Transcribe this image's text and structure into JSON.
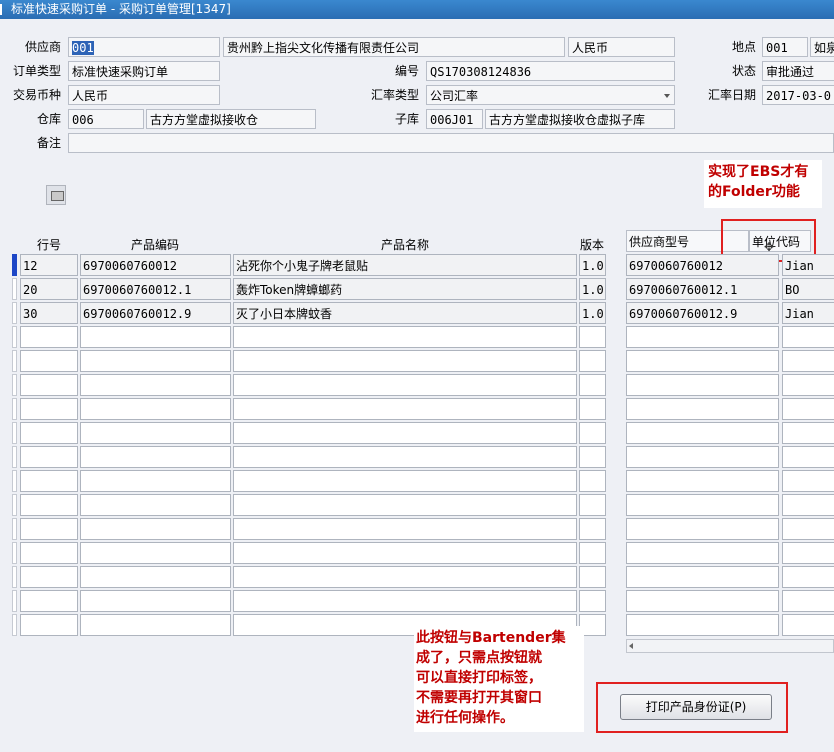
{
  "window": {
    "title": "标准快速采购订单 - 采购订单管理[1347]"
  },
  "header": {
    "supplier": {
      "label": "供应商",
      "code": "001",
      "name": "贵州黔上指尖文化传播有限责任公司",
      "currency": "人民币"
    },
    "location": {
      "label": "地点",
      "code": "001",
      "name": "如泉"
    },
    "order_type": {
      "label": "订单类型",
      "value": "标准快速采购订单"
    },
    "number": {
      "label": "编号",
      "value": "QS170308124836"
    },
    "status": {
      "label": "状态",
      "value": "审批通过"
    },
    "txn_currency": {
      "label": "交易币种",
      "value": "人民币"
    },
    "rate_type": {
      "label": "汇率类型",
      "value": "公司汇率"
    },
    "rate_date": {
      "label": "汇率日期",
      "value": "2017-03-0"
    },
    "warehouse": {
      "label": "仓库",
      "code": "006",
      "name": "古方方堂虚拟接收仓"
    },
    "subinventory": {
      "label": "子库",
      "code": "006J01",
      "name": "古方方堂虚拟接收仓虚拟子库"
    },
    "remark": {
      "label": "备注",
      "value": ""
    }
  },
  "lines": {
    "columns": {
      "line_no": "行号",
      "product_code": "产品编码",
      "product_name": "产品名称",
      "version": "版本"
    },
    "right_columns": {
      "supplier_model": "供应商型号",
      "unit_code": "单位代码"
    },
    "rows": [
      {
        "line_no": "12",
        "product_code": "6970060760012",
        "product_name": "沾死你个小鬼子牌老鼠贴",
        "version": "1.0",
        "supplier_model": "6970060760012",
        "unit_code": "Jian"
      },
      {
        "line_no": "20",
        "product_code": "6970060760012.1",
        "product_name": "轰炸Token牌蟑螂药",
        "version": "1.0",
        "supplier_model": "6970060760012.1",
        "unit_code": "BO"
      },
      {
        "line_no": "30",
        "product_code": "6970060760012.9",
        "product_name": "灭了小日本牌蚊香",
        "version": "1.0",
        "supplier_model": "6970060760012.9",
        "unit_code": "Jian"
      }
    ]
  },
  "annotations": {
    "folder_note": "实现了EBS才有\n的Folder功能",
    "bartender_note": "此按钮与Bartender集\n成了，只需点按钮就\n可以直接打印标签，\n不需要再打开其窗口\n进行任何操作。"
  },
  "buttons": {
    "print_label": "打印产品身份证(P)"
  },
  "colors": {
    "title_bar": "#2a6db3",
    "annotation_red": "#c00000",
    "current_row": "#1c46c6"
  }
}
